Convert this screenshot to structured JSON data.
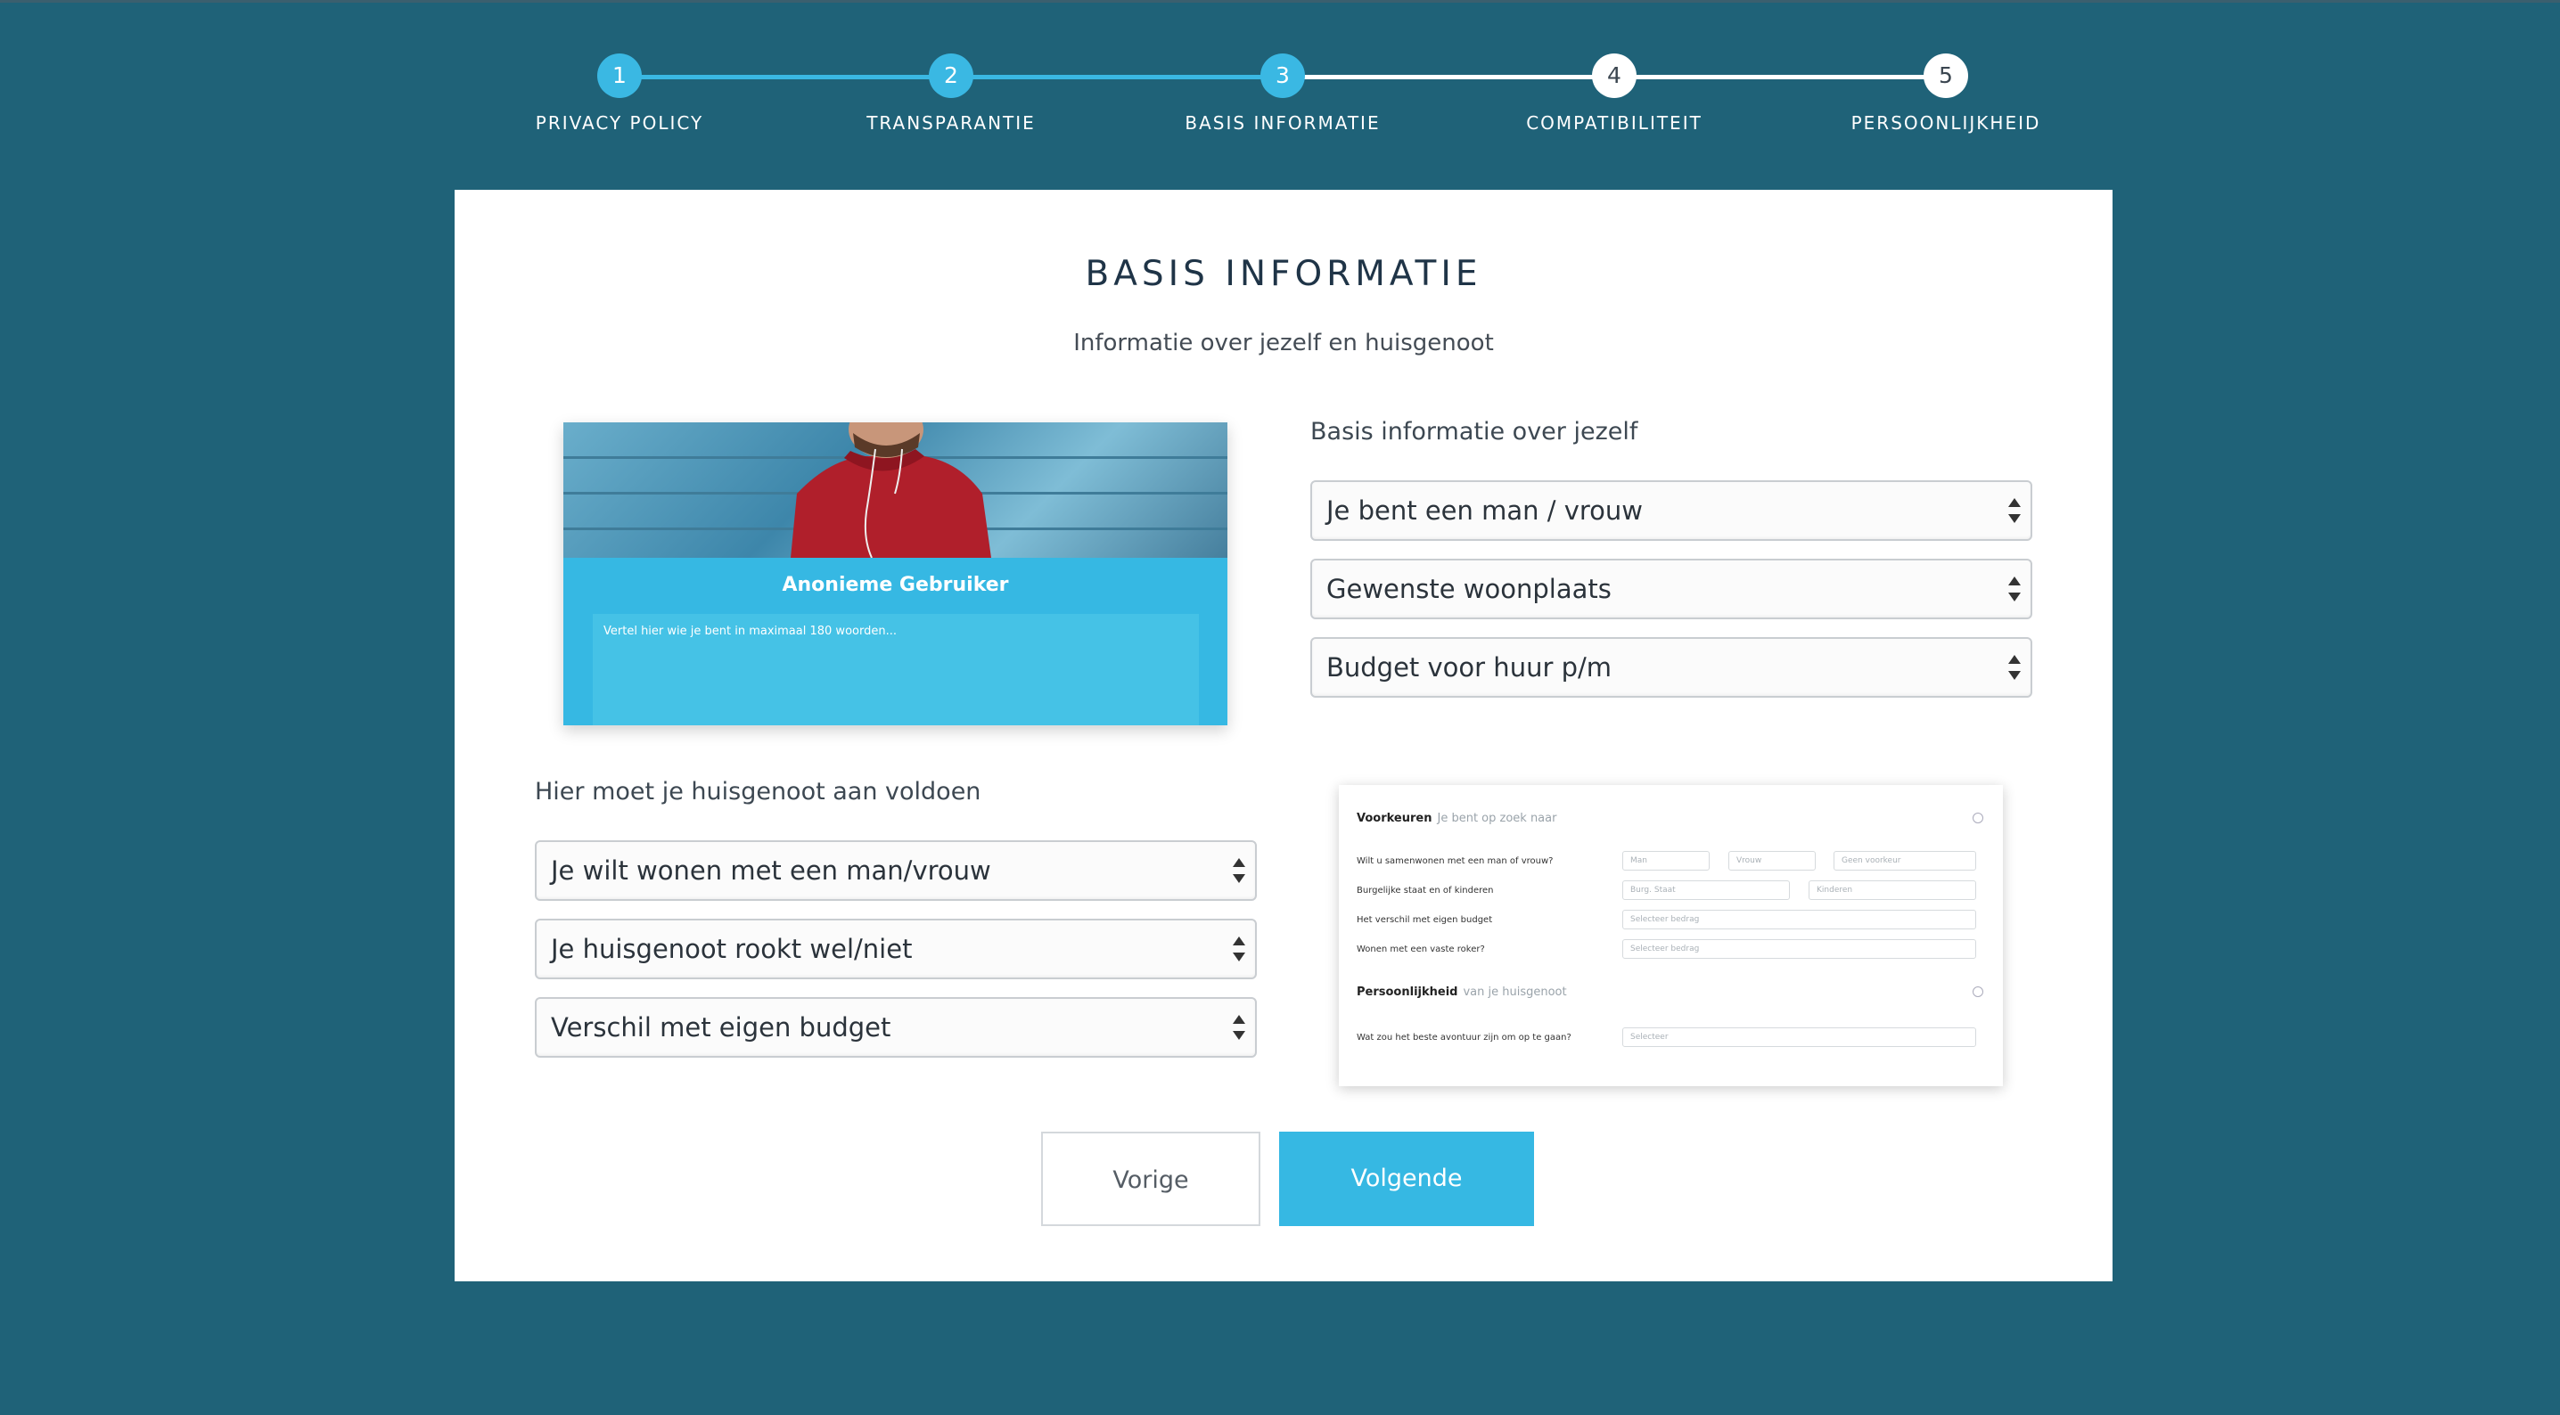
{
  "stepper": {
    "steps": [
      {
        "number": "1",
        "label": "PRIVACY POLICY",
        "state": "active"
      },
      {
        "number": "2",
        "label": "TRANSPARANTIE",
        "state": "active"
      },
      {
        "number": "3",
        "label": "BASIS INFORMATIE",
        "state": "active"
      },
      {
        "number": "4",
        "label": "COMPATIBILITEIT",
        "state": "inactive"
      },
      {
        "number": "5",
        "label": "PERSOONLIJKHEID",
        "state": "inactive"
      }
    ],
    "colors": {
      "active": "#3ab8e3",
      "inactive": "#ffffff"
    }
  },
  "card": {
    "title": "BASIS INFORMATIE",
    "subtitle": "Informatie over jezelf en huisgenoot"
  },
  "profile": {
    "name": "Anonieme Gebruiker",
    "text_placeholder": "Vertel hier wie je bent in maximaal 180 woorden..."
  },
  "self": {
    "label": "Basis informatie over jezelf",
    "selects": [
      "Je bent een man / vrouw",
      "Gewenste woonplaats",
      "Budget voor huur p/m"
    ]
  },
  "roommate": {
    "label": "Hier moet je huisgenoot aan voldoen",
    "selects": [
      "Je wilt wonen met een man/vrouw",
      "Je huisgenoot rookt wel/niet",
      "Verschil met eigen budget"
    ]
  },
  "preferences_mock": {
    "section1_title": "Voorkeuren",
    "section1_sub": "Je bent op zoek naar",
    "q1": "Wilt u samenwonen met een man of vrouw?",
    "q1_opts": [
      "Man",
      "Vrouw",
      "Geen voorkeur"
    ],
    "q2": "Burgelijke staat en of kinderen",
    "q2_opts": [
      "Burg. Staat",
      "Kinderen"
    ],
    "q3": "Het verschil met eigen budget",
    "q3_opt": "Selecteer bedrag",
    "q4": "Wonen met een vaste roker?",
    "q4_opt": "Selecteer bedrag",
    "section2_title": "Persoonlijkheid",
    "section2_sub": "van je huisgenoot",
    "q5": "Wat zou het beste avontuur zijn om op te gaan?",
    "q5_opt": "Selecteer"
  },
  "buttons": {
    "prev": "Vorige",
    "next": "Volgende"
  },
  "theme": {
    "background": "#1f6278",
    "accent": "#36b8e3"
  }
}
